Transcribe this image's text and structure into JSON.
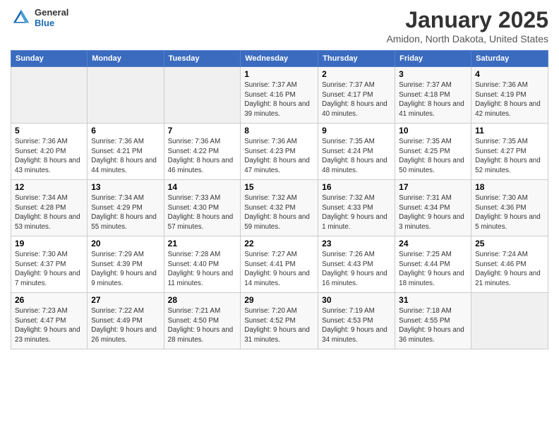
{
  "header": {
    "logo_general": "General",
    "logo_blue": "Blue",
    "title": "January 2025",
    "location": "Amidon, North Dakota, United States"
  },
  "calendar": {
    "days_of_week": [
      "Sunday",
      "Monday",
      "Tuesday",
      "Wednesday",
      "Thursday",
      "Friday",
      "Saturday"
    ],
    "weeks": [
      [
        {
          "day": "",
          "info": ""
        },
        {
          "day": "",
          "info": ""
        },
        {
          "day": "",
          "info": ""
        },
        {
          "day": "1",
          "info": "Sunrise: 7:37 AM\nSunset: 4:16 PM\nDaylight: 8 hours and 39 minutes."
        },
        {
          "day": "2",
          "info": "Sunrise: 7:37 AM\nSunset: 4:17 PM\nDaylight: 8 hours and 40 minutes."
        },
        {
          "day": "3",
          "info": "Sunrise: 7:37 AM\nSunset: 4:18 PM\nDaylight: 8 hours and 41 minutes."
        },
        {
          "day": "4",
          "info": "Sunrise: 7:36 AM\nSunset: 4:19 PM\nDaylight: 8 hours and 42 minutes."
        }
      ],
      [
        {
          "day": "5",
          "info": "Sunrise: 7:36 AM\nSunset: 4:20 PM\nDaylight: 8 hours and 43 minutes."
        },
        {
          "day": "6",
          "info": "Sunrise: 7:36 AM\nSunset: 4:21 PM\nDaylight: 8 hours and 44 minutes."
        },
        {
          "day": "7",
          "info": "Sunrise: 7:36 AM\nSunset: 4:22 PM\nDaylight: 8 hours and 46 minutes."
        },
        {
          "day": "8",
          "info": "Sunrise: 7:36 AM\nSunset: 4:23 PM\nDaylight: 8 hours and 47 minutes."
        },
        {
          "day": "9",
          "info": "Sunrise: 7:35 AM\nSunset: 4:24 PM\nDaylight: 8 hours and 48 minutes."
        },
        {
          "day": "10",
          "info": "Sunrise: 7:35 AM\nSunset: 4:25 PM\nDaylight: 8 hours and 50 minutes."
        },
        {
          "day": "11",
          "info": "Sunrise: 7:35 AM\nSunset: 4:27 PM\nDaylight: 8 hours and 52 minutes."
        }
      ],
      [
        {
          "day": "12",
          "info": "Sunrise: 7:34 AM\nSunset: 4:28 PM\nDaylight: 8 hours and 53 minutes."
        },
        {
          "day": "13",
          "info": "Sunrise: 7:34 AM\nSunset: 4:29 PM\nDaylight: 8 hours and 55 minutes."
        },
        {
          "day": "14",
          "info": "Sunrise: 7:33 AM\nSunset: 4:30 PM\nDaylight: 8 hours and 57 minutes."
        },
        {
          "day": "15",
          "info": "Sunrise: 7:32 AM\nSunset: 4:32 PM\nDaylight: 8 hours and 59 minutes."
        },
        {
          "day": "16",
          "info": "Sunrise: 7:32 AM\nSunset: 4:33 PM\nDaylight: 9 hours and 1 minute."
        },
        {
          "day": "17",
          "info": "Sunrise: 7:31 AM\nSunset: 4:34 PM\nDaylight: 9 hours and 3 minutes."
        },
        {
          "day": "18",
          "info": "Sunrise: 7:30 AM\nSunset: 4:36 PM\nDaylight: 9 hours and 5 minutes."
        }
      ],
      [
        {
          "day": "19",
          "info": "Sunrise: 7:30 AM\nSunset: 4:37 PM\nDaylight: 9 hours and 7 minutes."
        },
        {
          "day": "20",
          "info": "Sunrise: 7:29 AM\nSunset: 4:39 PM\nDaylight: 9 hours and 9 minutes."
        },
        {
          "day": "21",
          "info": "Sunrise: 7:28 AM\nSunset: 4:40 PM\nDaylight: 9 hours and 11 minutes."
        },
        {
          "day": "22",
          "info": "Sunrise: 7:27 AM\nSunset: 4:41 PM\nDaylight: 9 hours and 14 minutes."
        },
        {
          "day": "23",
          "info": "Sunrise: 7:26 AM\nSunset: 4:43 PM\nDaylight: 9 hours and 16 minutes."
        },
        {
          "day": "24",
          "info": "Sunrise: 7:25 AM\nSunset: 4:44 PM\nDaylight: 9 hours and 18 minutes."
        },
        {
          "day": "25",
          "info": "Sunrise: 7:24 AM\nSunset: 4:46 PM\nDaylight: 9 hours and 21 minutes."
        }
      ],
      [
        {
          "day": "26",
          "info": "Sunrise: 7:23 AM\nSunset: 4:47 PM\nDaylight: 9 hours and 23 minutes."
        },
        {
          "day": "27",
          "info": "Sunrise: 7:22 AM\nSunset: 4:49 PM\nDaylight: 9 hours and 26 minutes."
        },
        {
          "day": "28",
          "info": "Sunrise: 7:21 AM\nSunset: 4:50 PM\nDaylight: 9 hours and 28 minutes."
        },
        {
          "day": "29",
          "info": "Sunrise: 7:20 AM\nSunset: 4:52 PM\nDaylight: 9 hours and 31 minutes."
        },
        {
          "day": "30",
          "info": "Sunrise: 7:19 AM\nSunset: 4:53 PM\nDaylight: 9 hours and 34 minutes."
        },
        {
          "day": "31",
          "info": "Sunrise: 7:18 AM\nSunset: 4:55 PM\nDaylight: 9 hours and 36 minutes."
        },
        {
          "day": "",
          "info": ""
        }
      ]
    ]
  }
}
